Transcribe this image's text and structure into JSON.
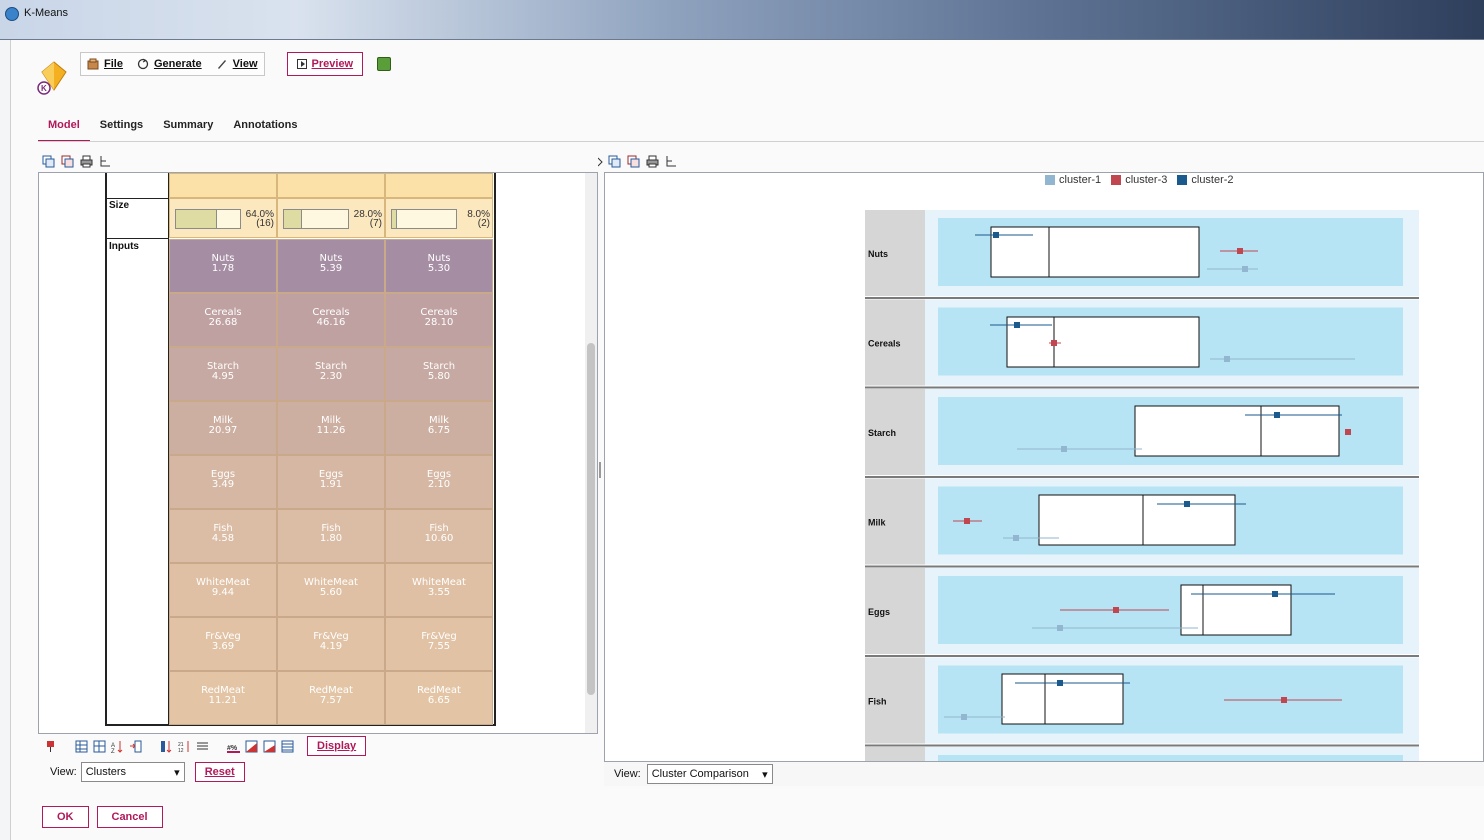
{
  "window": {
    "title": "K-Means"
  },
  "toolbar": {
    "file_label": "File",
    "generate_label": "Generate",
    "view_label": "View",
    "preview_label": "Preview"
  },
  "tabs": [
    {
      "label": "Model",
      "active": true
    },
    {
      "label": "Settings",
      "active": false
    },
    {
      "label": "Summary",
      "active": false
    },
    {
      "label": "Annotations",
      "active": false
    }
  ],
  "left_panel": {
    "size_label": "Size",
    "inputs_label": "Inputs",
    "clusters": [
      {
        "size_pct": "64.0%",
        "size_n": "(16)",
        "size_fraction": 0.64
      },
      {
        "size_pct": "28.0%",
        "size_n": "(7)",
        "size_fraction": 0.28
      },
      {
        "size_pct": "8.0%",
        "size_n": "(2)",
        "size_fraction": 0.08
      }
    ],
    "inputs": [
      {
        "name": "Nuts",
        "values": [
          "1.78",
          "5.39",
          "5.30"
        ],
        "color": "#a58ea3"
      },
      {
        "name": "Cereals",
        "values": [
          "26.68",
          "46.16",
          "28.10"
        ],
        "color": "#bfa1a2"
      },
      {
        "name": "Starch",
        "values": [
          "4.95",
          "2.30",
          "5.80"
        ],
        "color": "#c6a9a2"
      },
      {
        "name": "Milk",
        "values": [
          "20.97",
          "11.26",
          "6.75"
        ],
        "color": "#cdafa2"
      },
      {
        "name": "Eggs",
        "values": [
          "3.49",
          "1.91",
          "2.10"
        ],
        "color": "#d5b7a3"
      },
      {
        "name": "Fish",
        "values": [
          "4.58",
          "1.80",
          "10.60"
        ],
        "color": "#dbbca4"
      },
      {
        "name": "WhiteMeat",
        "values": [
          "9.44",
          "5.60",
          "3.55"
        ],
        "color": "#dfc0a4"
      },
      {
        "name": "Fr&Veg",
        "values": [
          "3.69",
          "4.19",
          "7.55"
        ],
        "color": "#e1c2a5"
      },
      {
        "name": "RedMeat",
        "values": [
          "11.21",
          "7.57",
          "6.65"
        ],
        "color": "#e3c5a6"
      }
    ],
    "display_label": "Display",
    "view_label": "View:",
    "view_value": "Clusters",
    "reset_label": "Reset"
  },
  "right_panel": {
    "legend": [
      {
        "name": "cluster-1",
        "color": "#92b6cf"
      },
      {
        "name": "cluster-3",
        "color": "#c0474f"
      },
      {
        "name": "cluster-2",
        "color": "#1a5a8c"
      }
    ],
    "view_label": "View:",
    "view_value": "Cluster Comparison"
  },
  "chart_data": {
    "type": "boxplot-comparison",
    "variables": [
      "Nuts",
      "Cereals",
      "Starch",
      "Milk",
      "Eggs",
      "Fish"
    ],
    "series": [
      {
        "name": "cluster-1",
        "color": "#92b6cf"
      },
      {
        "name": "cluster-3",
        "color": "#c0474f"
      },
      {
        "name": "cluster-2",
        "color": "#1a5a8c"
      }
    ]
  },
  "buttons": {
    "ok_label": "OK",
    "cancel_label": "Cancel"
  },
  "colors": {
    "accent": "#b0195a",
    "chart_bg": "#b6e4f4"
  }
}
